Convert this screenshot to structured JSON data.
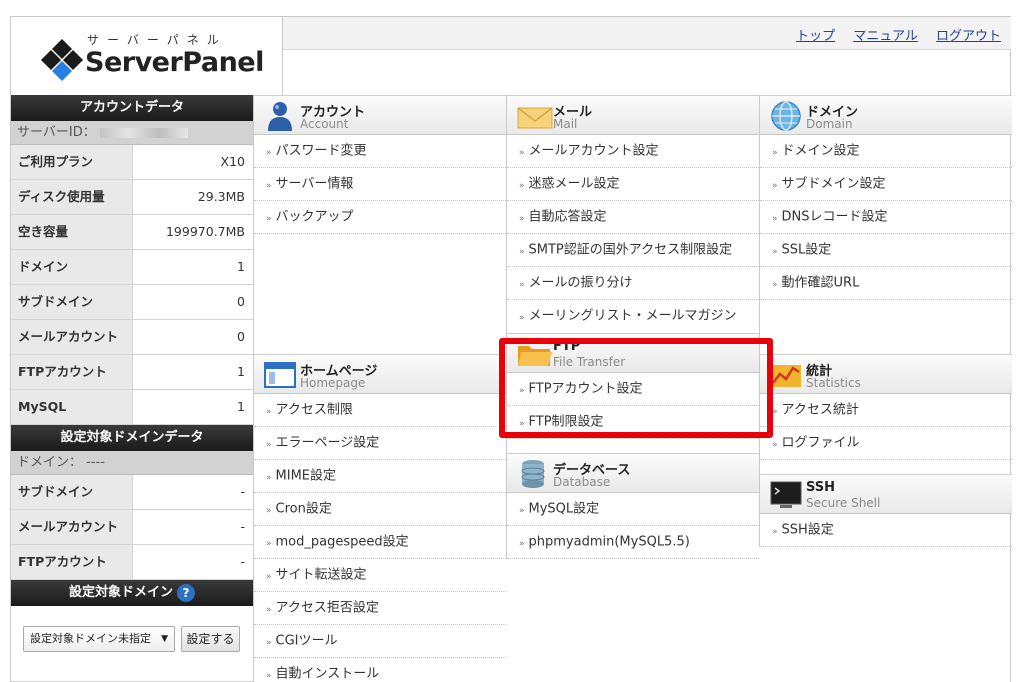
{
  "logo": {
    "kana": "サーバーパネル",
    "name": "ServerPanel"
  },
  "toplinks": [
    {
      "label": "トップ"
    },
    {
      "label": "マニュアル"
    },
    {
      "label": "ログアウト"
    }
  ],
  "account_data": {
    "title": "アカウントデータ",
    "server_id_label": "サーバーID：",
    "rows": [
      {
        "label": "ご利用プラン",
        "value": "X10"
      },
      {
        "label": "ディスク使用量",
        "value": "29.3MB"
      },
      {
        "label": "空き容量",
        "value": "199970.7MB"
      },
      {
        "label": "ドメイン",
        "value": "1"
      },
      {
        "label": "サブドメイン",
        "value": "0"
      },
      {
        "label": "メールアカウント",
        "value": "0"
      },
      {
        "label": "FTPアカウント",
        "value": "1"
      },
      {
        "label": "MySQL",
        "value": "1"
      }
    ]
  },
  "domain_data": {
    "title": "設定対象ドメインデータ",
    "domain_label": "ドメイン： ----",
    "rows": [
      {
        "label": "サブドメイン",
        "value": "-"
      },
      {
        "label": "メールアカウント",
        "value": "-"
      },
      {
        "label": "FTPアカウント",
        "value": "-"
      }
    ]
  },
  "target_domain": {
    "title": "設定対象ドメイン",
    "help": "?",
    "select_value": "設定対象ドメイン未指定",
    "button": "設定する"
  },
  "sections": {
    "account": {
      "jp": "アカウント",
      "en": "Account",
      "items": [
        "パスワード変更",
        "サーバー情報",
        "バックアップ"
      ]
    },
    "mail": {
      "jp": "メール",
      "en": "Mail",
      "items": [
        "メールアカウント設定",
        "迷惑メール設定",
        "自動応答設定",
        "SMTP認証の国外アクセス制限設定",
        "メールの振り分け",
        "メーリングリスト・メールマガジン"
      ]
    },
    "domain": {
      "jp": "ドメイン",
      "en": "Domain",
      "items": [
        "ドメイン設定",
        "サブドメイン設定",
        "DNSレコード設定",
        "SSL設定",
        "動作確認URL"
      ]
    },
    "homepage": {
      "jp": "ホームページ",
      "en": "Homepage",
      "items": [
        "アクセス制限",
        "エラーページ設定",
        "MIME設定",
        "Cron設定",
        "mod_pagespeed設定",
        "サイト転送設定",
        "アクセス拒否設定",
        "CGIツール",
        "自動インストール"
      ]
    },
    "ftp": {
      "jp": "FTP",
      "en": "File Transfer",
      "items": [
        "FTPアカウント設定",
        "FTP制限設定"
      ]
    },
    "stats": {
      "jp": "統計",
      "en": "Statistics",
      "items": [
        "アクセス統計",
        "ログファイル"
      ]
    },
    "database": {
      "jp": "データベース",
      "en": "Database",
      "items": [
        "MySQL設定",
        "phpmyadmin(MySQL5.5)"
      ]
    },
    "ssh": {
      "jp": "SSH",
      "en": "Secure Shell",
      "items": [
        "SSH設定"
      ]
    }
  }
}
